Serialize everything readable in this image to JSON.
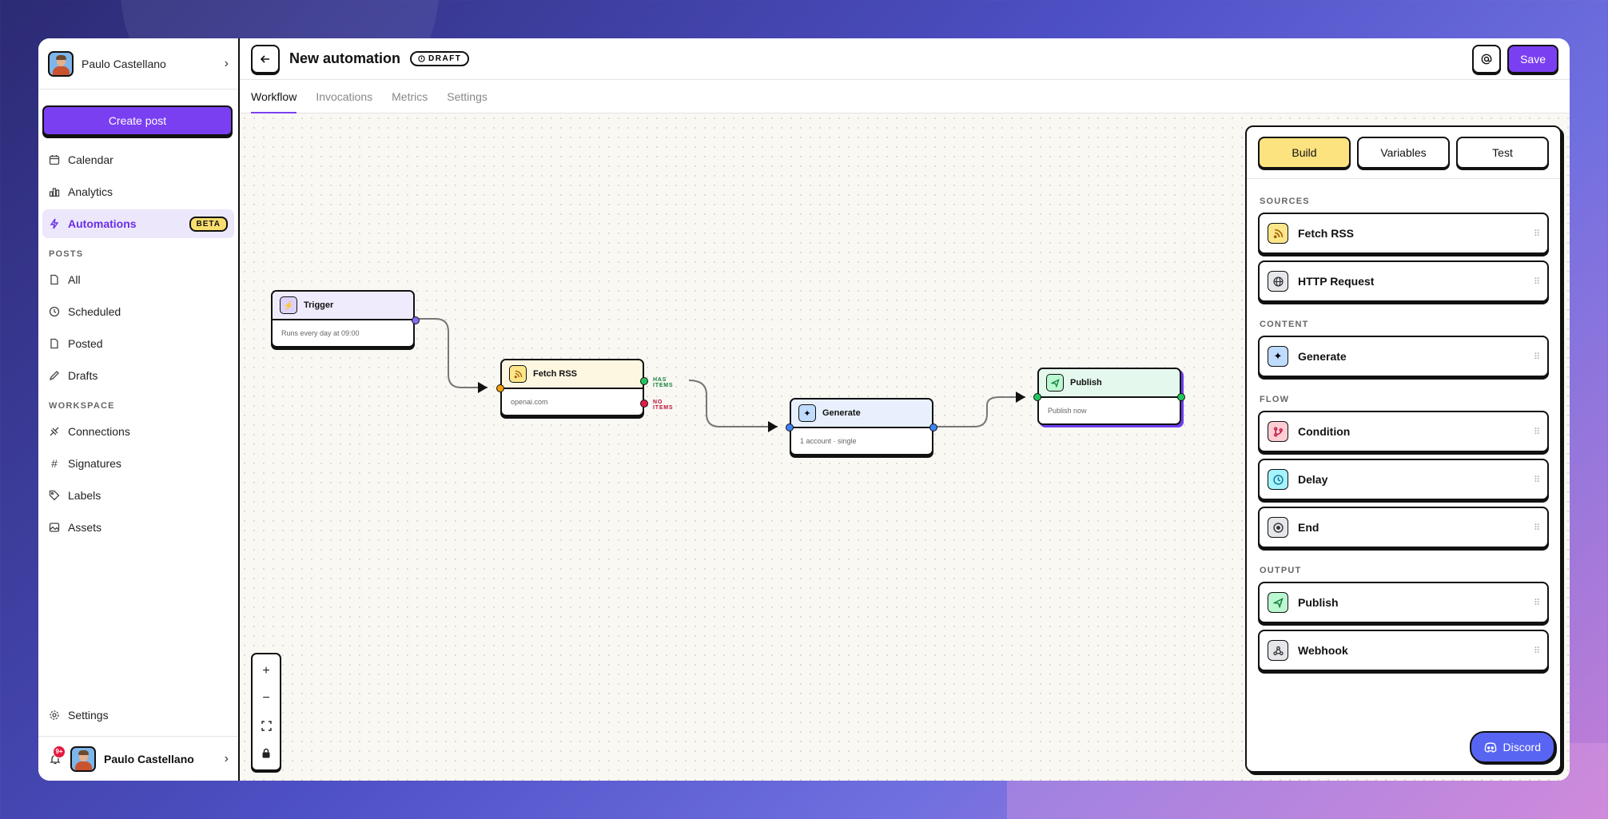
{
  "user": {
    "name": "Paulo Castellano",
    "notifications": "9+"
  },
  "sidebar": {
    "create_post": "Create post",
    "main_items": [
      {
        "label": "Calendar",
        "icon": "calendar-icon"
      },
      {
        "label": "Analytics",
        "icon": "bar-chart-icon"
      },
      {
        "label": "Automations",
        "icon": "bolt-icon",
        "badge": "BETA",
        "active": true
      }
    ],
    "posts_label": "POSTS",
    "posts_items": [
      {
        "label": "All",
        "icon": "document-icon"
      },
      {
        "label": "Scheduled",
        "icon": "clock-icon"
      },
      {
        "label": "Posted",
        "icon": "document-icon"
      },
      {
        "label": "Drafts",
        "icon": "pencil-icon"
      }
    ],
    "workspace_label": "WORKSPACE",
    "workspace_items": [
      {
        "label": "Connections",
        "icon": "link-icon"
      },
      {
        "label": "Signatures",
        "icon": "hash-icon"
      },
      {
        "label": "Labels",
        "icon": "tag-icon"
      },
      {
        "label": "Assets",
        "icon": "image-icon"
      }
    ],
    "settings": "Settings"
  },
  "header": {
    "title": "New automation",
    "status": "DRAFT",
    "save": "Save"
  },
  "tabs": [
    "Workflow",
    "Invocations",
    "Metrics",
    "Settings"
  ],
  "nodes": {
    "trigger": {
      "title": "Trigger",
      "subtitle": "Runs every day at 09:00"
    },
    "fetch_rss": {
      "title": "Fetch RSS",
      "subtitle": "openai.com",
      "has_items": "HAS ITEMS",
      "no_items": "NO ITEMS"
    },
    "generate": {
      "title": "Generate",
      "subtitle": "1 account · single"
    },
    "publish": {
      "title": "Publish",
      "subtitle": "Publish now"
    }
  },
  "panel": {
    "tabs": [
      "Build",
      "Variables",
      "Test"
    ],
    "sources_label": "SOURCES",
    "sources": [
      {
        "label": "Fetch RSS",
        "icon": "rss-icon",
        "color": "#fde68a"
      },
      {
        "label": "HTTP Request",
        "icon": "globe-icon",
        "color": "#e5e7eb"
      }
    ],
    "content_label": "CONTENT",
    "content": [
      {
        "label": "Generate",
        "icon": "sparkles-icon",
        "color": "#bfdbfe"
      }
    ],
    "flow_label": "FLOW",
    "flow": [
      {
        "label": "Condition",
        "icon": "branch-icon",
        "color": "#fecdd3"
      },
      {
        "label": "Delay",
        "icon": "clock-icon",
        "color": "#a5f3fc"
      },
      {
        "label": "End",
        "icon": "stop-icon",
        "color": "#e5e7eb"
      }
    ],
    "output_label": "OUTPUT",
    "output": [
      {
        "label": "Publish",
        "icon": "send-icon",
        "color": "#bbf7d0"
      },
      {
        "label": "Webhook",
        "icon": "webhook-icon",
        "color": "#e5e7eb"
      }
    ],
    "discord": "Discord"
  },
  "colors": {
    "accent": "#7b3ff2",
    "build_tab": "#fde380",
    "discord": "#5865f2"
  }
}
